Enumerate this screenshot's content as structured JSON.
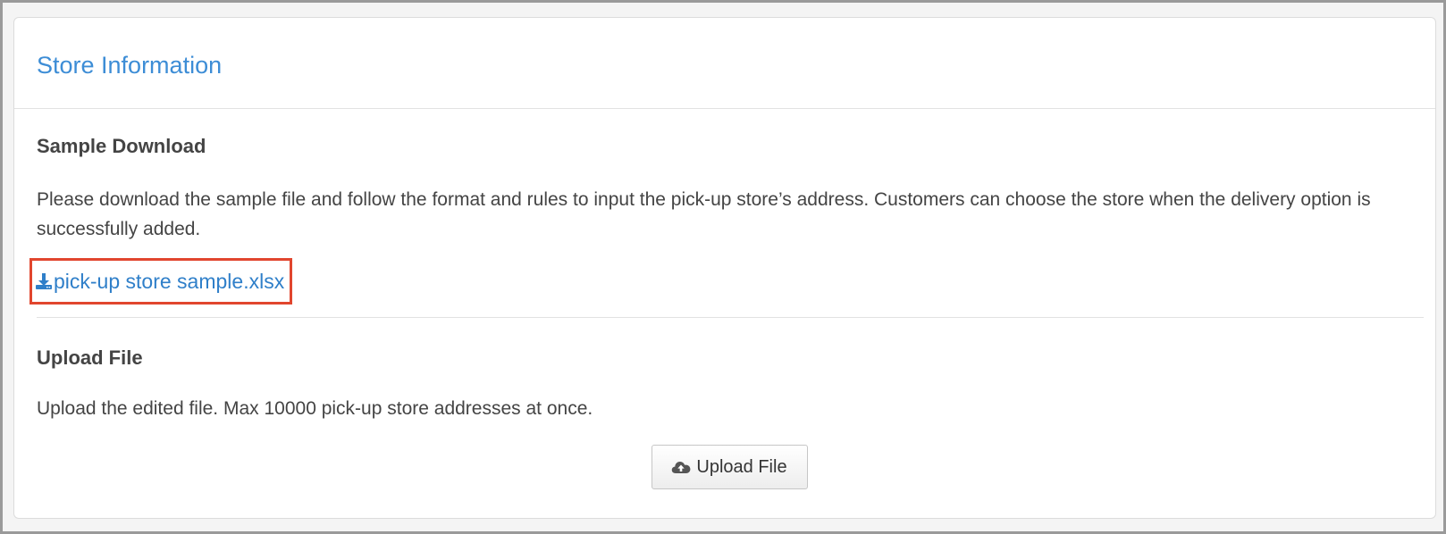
{
  "panel": {
    "title": "Store Information"
  },
  "sample_section": {
    "title": "Sample Download",
    "description": "Please download the sample file and follow the format and rules to input the pick-up store’s address. Customers can choose the store when the delivery option is successfully added.",
    "download_link_label": "pick-up store sample.xlsx",
    "download_icon": "download-icon"
  },
  "upload_section": {
    "title": "Upload File",
    "description": "Upload the edited file. Max 10000 pick-up store addresses at once.",
    "button_label": "Upload File",
    "button_icon": "cloud-upload-icon"
  },
  "colors": {
    "title_blue": "#3d8dd6",
    "link_blue": "#2f7fc9",
    "highlight_red": "#e1462e"
  }
}
